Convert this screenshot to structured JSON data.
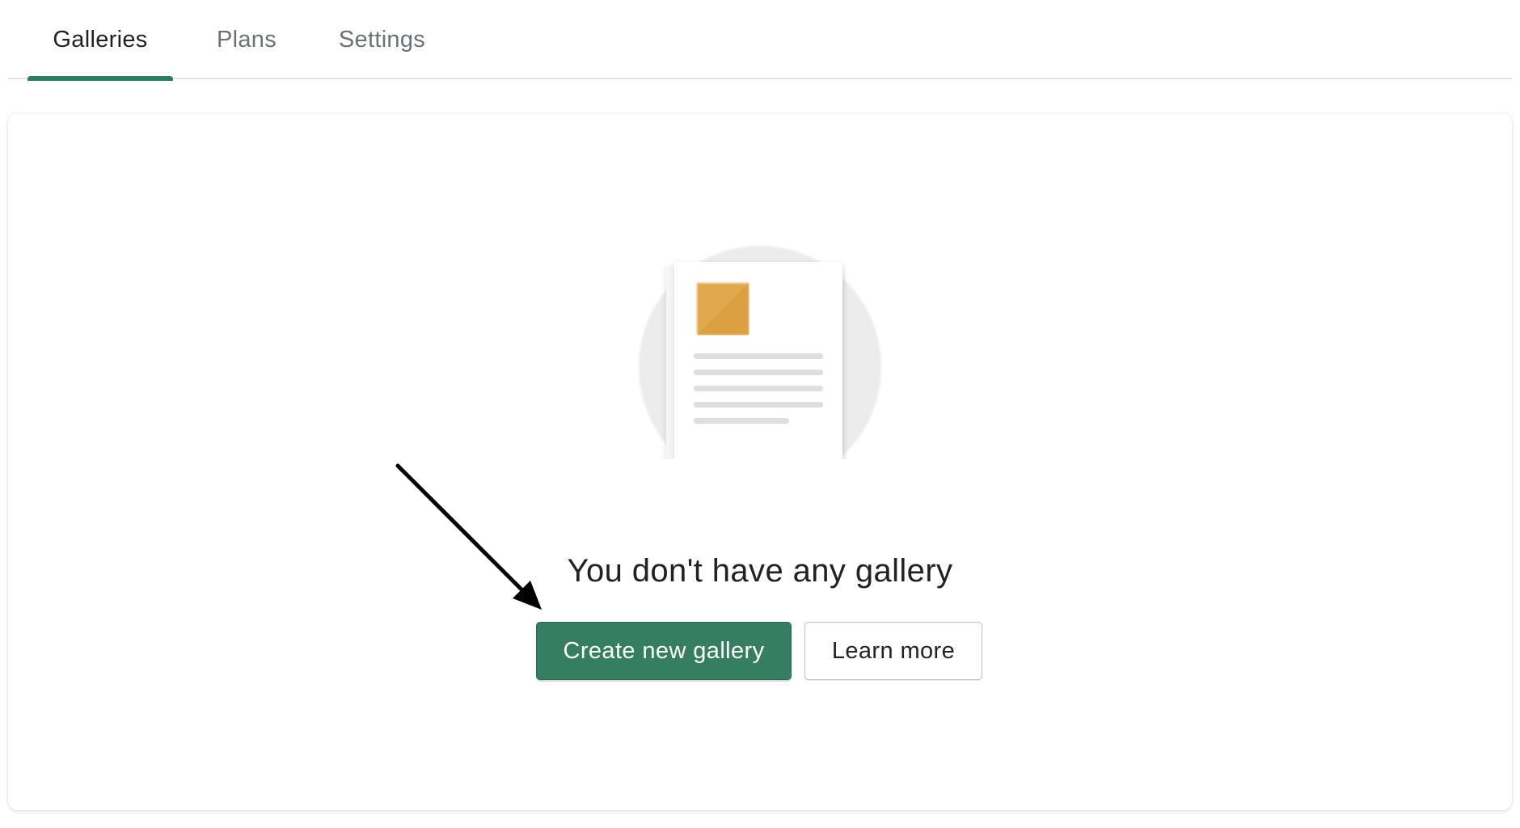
{
  "tabs": [
    {
      "label": "Galleries",
      "active": true
    },
    {
      "label": "Plans",
      "active": false
    },
    {
      "label": "Settings",
      "active": false
    }
  ],
  "empty_state": {
    "illustration": "document-icon",
    "title": "You don't have any gallery",
    "primary_button_label": "Create new gallery",
    "secondary_button_label": "Learn more"
  },
  "annotation": {
    "icon": "arrow-icon"
  },
  "colors": {
    "accent": "#357e61",
    "tab_indicator": "#2f7d5e",
    "illustration_square": "#e0a94e"
  }
}
